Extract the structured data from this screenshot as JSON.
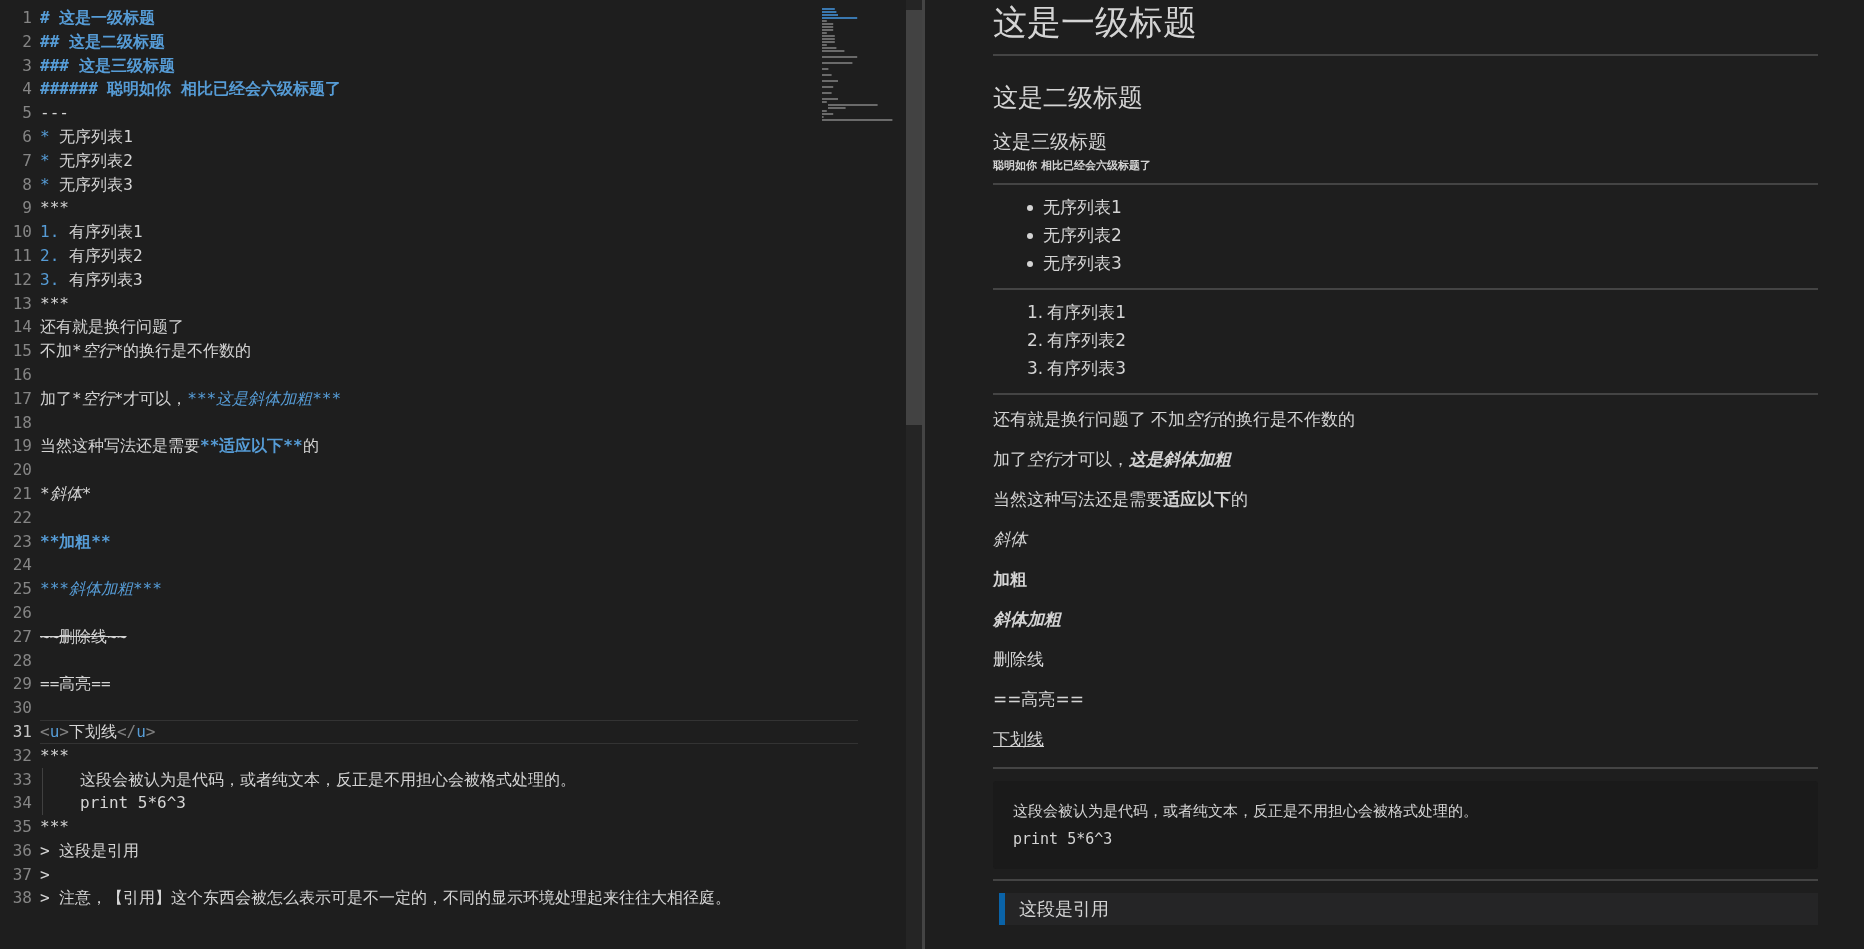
{
  "editor": {
    "lines": [
      {
        "number": "1",
        "current": false,
        "tokens": [
          {
            "text": "# 这是一级标题",
            "kind": "heading"
          }
        ]
      },
      {
        "number": "2",
        "current": false,
        "tokens": [
          {
            "text": "## 这是二级标题",
            "kind": "heading"
          }
        ]
      },
      {
        "number": "3",
        "current": false,
        "tokens": [
          {
            "text": "### 这是三级标题",
            "kind": "heading"
          }
        ]
      },
      {
        "number": "4",
        "current": false,
        "tokens": [
          {
            "text": "###### 聪明如你 相比已经会六级标题了",
            "kind": "heading"
          }
        ]
      },
      {
        "number": "5",
        "current": false,
        "tokens": [
          {
            "text": "---",
            "kind": "plain"
          }
        ]
      },
      {
        "number": "6",
        "current": false,
        "tokens": [
          {
            "text": "* ",
            "kind": "mark"
          },
          {
            "text": "无序列表1",
            "kind": "plain"
          }
        ]
      },
      {
        "number": "7",
        "current": false,
        "tokens": [
          {
            "text": "* ",
            "kind": "mark"
          },
          {
            "text": "无序列表2",
            "kind": "plain"
          }
        ]
      },
      {
        "number": "8",
        "current": false,
        "tokens": [
          {
            "text": "* ",
            "kind": "mark"
          },
          {
            "text": "无序列表3",
            "kind": "plain"
          }
        ]
      },
      {
        "number": "9",
        "current": false,
        "tokens": [
          {
            "text": "***",
            "kind": "plain"
          }
        ]
      },
      {
        "number": "10",
        "current": false,
        "tokens": [
          {
            "text": "1. ",
            "kind": "mark"
          },
          {
            "text": "有序列表1",
            "kind": "plain"
          }
        ]
      },
      {
        "number": "11",
        "current": false,
        "tokens": [
          {
            "text": "2. ",
            "kind": "mark"
          },
          {
            "text": "有序列表2",
            "kind": "plain"
          }
        ]
      },
      {
        "number": "12",
        "current": false,
        "tokens": [
          {
            "text": "3. ",
            "kind": "mark"
          },
          {
            "text": "有序列表3",
            "kind": "plain"
          }
        ]
      },
      {
        "number": "13",
        "current": false,
        "tokens": [
          {
            "text": "***",
            "kind": "plain"
          }
        ]
      },
      {
        "number": "14",
        "current": false,
        "tokens": [
          {
            "text": "还有就是换行问题了",
            "kind": "plain"
          }
        ]
      },
      {
        "number": "15",
        "current": false,
        "tokens": [
          {
            "text": "不加*",
            "kind": "plain"
          },
          {
            "text": "空行",
            "kind": "italic"
          },
          {
            "text": "*的换行是不作数的",
            "kind": "plain"
          }
        ]
      },
      {
        "number": "16",
        "current": false
      },
      {
        "number": "17",
        "current": false,
        "tokens": [
          {
            "text": "加了*",
            "kind": "plain"
          },
          {
            "text": "空行",
            "kind": "italic"
          },
          {
            "text": "*才可以，",
            "kind": "plain"
          },
          {
            "text": "***",
            "kind": "mark"
          },
          {
            "text": "这是斜体加粗",
            "kind": "mark-italic"
          },
          {
            "text": "***",
            "kind": "mark"
          }
        ]
      },
      {
        "number": "18",
        "current": false
      },
      {
        "number": "19",
        "current": false,
        "tokens": [
          {
            "text": "当然这种写法还是需要",
            "kind": "plain"
          },
          {
            "text": "**适应以下**",
            "kind": "mark-bold"
          },
          {
            "text": "的",
            "kind": "plain"
          }
        ]
      },
      {
        "number": "20",
        "current": false
      },
      {
        "number": "21",
        "current": false,
        "tokens": [
          {
            "text": "*斜体*",
            "kind": "italic"
          }
        ]
      },
      {
        "number": "22",
        "current": false
      },
      {
        "number": "23",
        "current": false,
        "tokens": [
          {
            "text": "**加粗**",
            "kind": "mark-bold"
          }
        ]
      },
      {
        "number": "24",
        "current": false
      },
      {
        "number": "25",
        "current": false,
        "tokens": [
          {
            "text": "***",
            "kind": "mark"
          },
          {
            "text": "斜体加粗",
            "kind": "mark-italic"
          },
          {
            "text": "***",
            "kind": "mark"
          }
        ]
      },
      {
        "number": "26",
        "current": false
      },
      {
        "number": "27",
        "current": false,
        "tokens": [
          {
            "text": "~~删除线~~",
            "kind": "strike"
          }
        ]
      },
      {
        "number": "28",
        "current": false
      },
      {
        "number": "29",
        "current": false,
        "tokens": [
          {
            "text": "==高亮==",
            "kind": "plain"
          }
        ]
      },
      {
        "number": "30",
        "current": false
      },
      {
        "number": "31",
        "current": true,
        "tokens": [
          {
            "text": "<",
            "kind": "punct"
          },
          {
            "text": "u",
            "kind": "tag"
          },
          {
            "text": ">",
            "kind": "punct"
          },
          {
            "text": "下划线",
            "kind": "plain"
          },
          {
            "text": "</",
            "kind": "punct"
          },
          {
            "text": "u",
            "kind": "tag"
          },
          {
            "text": ">",
            "kind": "punct"
          }
        ]
      },
      {
        "number": "32",
        "current": false,
        "tokens": [
          {
            "text": "***",
            "kind": "plain"
          }
        ]
      },
      {
        "number": "33",
        "current": false,
        "indented": true,
        "tokens": [
          {
            "text": "这段会被认为是代码，或者纯文本，反正是不用担心会被格式处理的。",
            "kind": "plain"
          }
        ]
      },
      {
        "number": "34",
        "current": false,
        "indented": true,
        "tokens": [
          {
            "text": "print 5*6^3",
            "kind": "plain"
          }
        ]
      },
      {
        "number": "35",
        "current": false,
        "tokens": [
          {
            "text": "***",
            "kind": "plain"
          }
        ]
      },
      {
        "number": "36",
        "current": false,
        "tokens": [
          {
            "text": "> 这段是引用",
            "kind": "plain"
          }
        ]
      },
      {
        "number": "37",
        "current": false,
        "tokens": [
          {
            "text": ">",
            "kind": "plain"
          }
        ]
      },
      {
        "number": "38",
        "current": false,
        "tokens": [
          {
            "text": "> 注意，【引用】这个东西会被怎么表示可是不一定的，不同的显示环境处理起来往往大相径庭。",
            "kind": "plain"
          }
        ]
      }
    ]
  },
  "preview": {
    "blocks": [
      {
        "kind": "h1",
        "text": "这是一级标题"
      },
      {
        "kind": "hr"
      },
      {
        "kind": "h2",
        "text": "这是二级标题"
      },
      {
        "kind": "h3",
        "text": "这是三级标题"
      },
      {
        "kind": "h6",
        "text": "聪明如你 相比已经会六级标题了"
      },
      {
        "kind": "hr"
      },
      {
        "kind": "ul",
        "items": [
          "无序列表1",
          "无序列表2",
          "无序列表3"
        ]
      },
      {
        "kind": "hr"
      },
      {
        "kind": "ol",
        "items": [
          {
            "marker": "1.",
            "text": "有序列表1"
          },
          {
            "marker": "2.",
            "text": "有序列表2"
          },
          {
            "marker": "3.",
            "text": "有序列表3"
          }
        ]
      },
      {
        "kind": "hr"
      },
      {
        "kind": "p",
        "parts": [
          {
            "text": "还有就是换行问题了 不加",
            "kind": "plain"
          },
          {
            "text": "空行",
            "kind": "italic"
          },
          {
            "text": "的换行是不作数的",
            "kind": "plain"
          }
        ]
      },
      {
        "kind": "p",
        "parts": [
          {
            "text": "加了",
            "kind": "plain"
          },
          {
            "text": "空行",
            "kind": "italic"
          },
          {
            "text": "才可以，",
            "kind": "plain"
          },
          {
            "text": "这是斜体加粗",
            "kind": "bold-italic"
          }
        ]
      },
      {
        "kind": "p",
        "parts": [
          {
            "text": "当然这种写法还是需要",
            "kind": "plain"
          },
          {
            "text": "适应以下",
            "kind": "bold"
          },
          {
            "text": "的",
            "kind": "plain"
          }
        ]
      },
      {
        "kind": "p",
        "parts": [
          {
            "text": "斜体",
            "kind": "italic"
          }
        ]
      },
      {
        "kind": "p",
        "parts": [
          {
            "text": "加粗",
            "kind": "bold"
          }
        ]
      },
      {
        "kind": "p",
        "parts": [
          {
            "text": "斜体加粗",
            "kind": "bold-italic"
          }
        ]
      },
      {
        "kind": "p",
        "parts": [
          {
            "text": "删除线",
            "kind": "plain"
          }
        ]
      },
      {
        "kind": "p",
        "parts": [
          {
            "text": "==高亮==",
            "kind": "plain"
          }
        ]
      },
      {
        "kind": "p",
        "parts": [
          {
            "text": "下划线",
            "kind": "underline"
          }
        ]
      },
      {
        "kind": "hr"
      },
      {
        "kind": "code",
        "lines": [
          "这段会被认为是代码，或者纯文本，反正是不用担心会被格式处理的。",
          "print 5*6^3"
        ]
      },
      {
        "kind": "hr"
      },
      {
        "kind": "quote",
        "text": "这段是引用"
      }
    ]
  }
}
